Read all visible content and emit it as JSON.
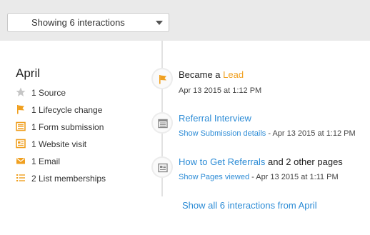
{
  "filter": {
    "label": "Showing 6 interactions"
  },
  "month": "April",
  "summary": [
    {
      "icon": "star-icon",
      "text": "1 Source"
    },
    {
      "icon": "flag-icon",
      "text": "1 Lifecycle change"
    },
    {
      "icon": "form-icon",
      "text": "1 Form submission"
    },
    {
      "icon": "webpage-icon",
      "text": "1 Website visit"
    },
    {
      "icon": "email-icon",
      "text": "1 Email"
    },
    {
      "icon": "list-icon",
      "text": "2 List memberships"
    }
  ],
  "events": [
    {
      "icon": "flag-icon",
      "title_prefix": "Became a ",
      "title_link": "Lead",
      "detail": "Apr 13 2015 at 1:12 PM"
    },
    {
      "icon": "form-icon",
      "title_link": "Referral Interview",
      "detail_link": "Show Submission details",
      "detail": " - Apr 13 2015 at 1:12 PM"
    },
    {
      "icon": "webpage-icon",
      "title_link": "How to Get Referrals",
      "title_suffix": " and 2 other pages",
      "detail_link": "Show Pages viewed",
      "detail": " - Apr 13 2015 at 1:11 PM"
    }
  ],
  "show_all": "Show all 6 interactions from April",
  "colors": {
    "accent_orange": "#f0a020",
    "link_blue": "#2d8cd6",
    "topbar": "#eaeaea"
  }
}
